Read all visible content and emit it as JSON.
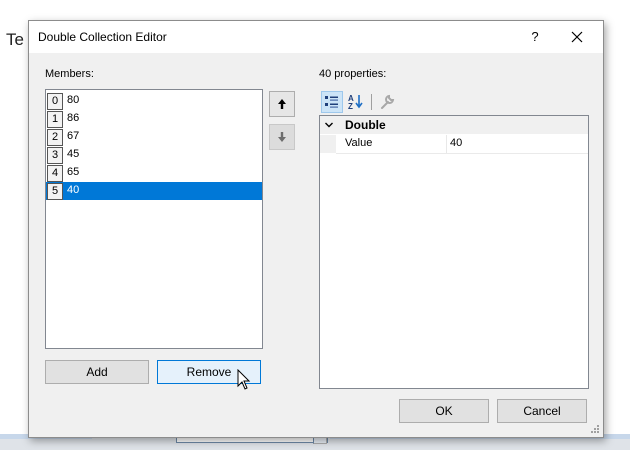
{
  "background": {
    "partial_text": "Te"
  },
  "dialog": {
    "title": "Double Collection Editor",
    "help_label": "?",
    "members_label": "Members:",
    "members": [
      {
        "index": "0",
        "value": "80"
      },
      {
        "index": "1",
        "value": "86"
      },
      {
        "index": "2",
        "value": "67"
      },
      {
        "index": "3",
        "value": "45"
      },
      {
        "index": "4",
        "value": "65"
      },
      {
        "index": "5",
        "value": "40"
      }
    ],
    "selected_index": 5,
    "add_label": "Add",
    "remove_label": "Remove",
    "ok_label": "OK",
    "cancel_label": "Cancel",
    "properties_label": "40 properties:",
    "property_grid": {
      "category": "Double",
      "rows": [
        {
          "name": "Value",
          "value": "40"
        }
      ]
    }
  },
  "colors": {
    "selection": "#0078d7",
    "dialog_bg": "#f0f0f0",
    "focus_border": "#0078d7"
  },
  "icons": {
    "move_up": "arrow-up-icon",
    "move_down": "arrow-down-icon",
    "categorized": "categorized-icon",
    "alphabetical": "alphabetical-sort-icon",
    "property_pages": "wrench-icon",
    "close": "close-icon",
    "category_expand": "chevron-down-icon"
  }
}
